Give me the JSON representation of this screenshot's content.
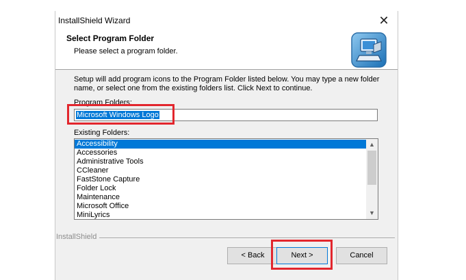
{
  "window": {
    "title": "InstallShield Wizard",
    "close_glyph": "✕"
  },
  "header": {
    "title": "Select Program Folder",
    "subtitle": "Please select a program folder.",
    "logo_icon": "installer-computer-icon"
  },
  "body": {
    "description_line1": "Setup will add program icons to the Program Folder listed below.  You may type a new folder",
    "description_line2": "name, or select one from the existing folders list.  Click Next to continue.",
    "program_folders_label": "Program Folders:",
    "program_folder_value": "Microsoft Windows Logo",
    "existing_folders_label": "Existing Folders:",
    "existing_folders": [
      "Accessibility",
      "Accessories",
      "Administrative Tools",
      "CCleaner",
      "FastStone Capture",
      "Folder Lock",
      "Maintenance",
      "Microsoft Office",
      "MiniLyrics"
    ],
    "selected_folder_index": 0
  },
  "footer": {
    "brand": "InstallShield",
    "back_label": "< Back",
    "next_label": "Next >",
    "cancel_label": "Cancel"
  },
  "colors": {
    "selection": "#0078d7",
    "annotation": "#e2262d"
  }
}
